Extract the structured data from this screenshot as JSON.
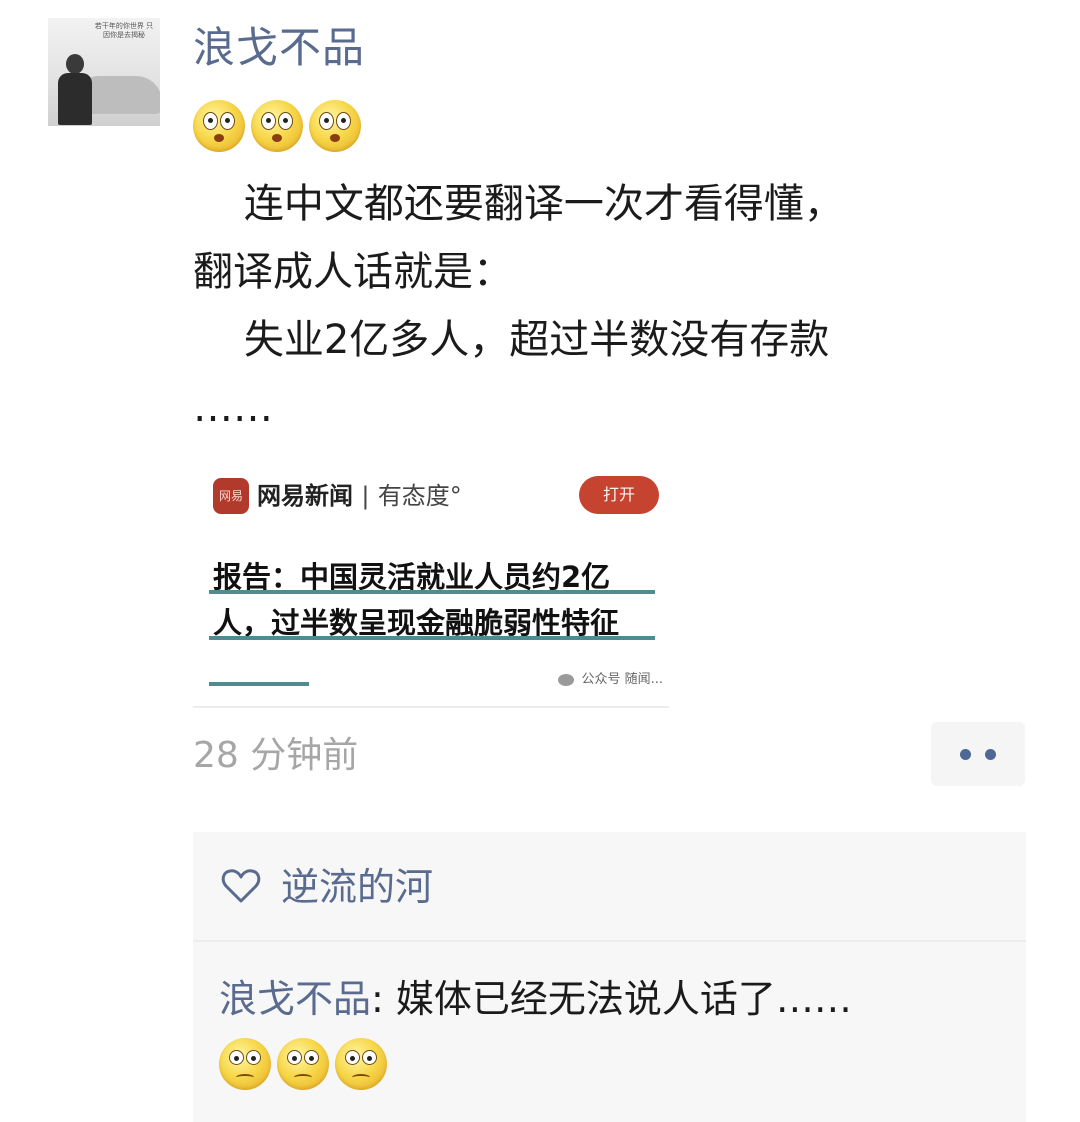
{
  "post": {
    "username": "浪戈不品",
    "avatar_caption": "若干年的你世界\n只因你是去揭秘",
    "emoji_top": [
      "blank-stare-emoji",
      "blank-stare-emoji",
      "blank-stare-emoji"
    ],
    "text_lines": [
      "    连中文都还要翻译一次才看得懂，",
      "翻译成人话就是：",
      "    失业2亿多人，超过半数没有存款",
      "……"
    ],
    "timestamp": "28 分钟前",
    "more_icon": "two-dots-icon"
  },
  "shared_card": {
    "logo_text": "网易",
    "brand_name": "网易新闻",
    "brand_separator": "|",
    "brand_slogan": "有态度°",
    "open_button": "打开",
    "headline": "报告：中国灵活就业人员约2亿人，过半数呈现金融脆弱性特征",
    "source_label": "公众号",
    "source_name": "随闻..."
  },
  "interactions": {
    "like_icon": "heart-outline-icon",
    "liker": "逆流的河",
    "comments": [
      {
        "author": "浪戈不品",
        "separator": ": ",
        "text": "媒体已经无法说人话了……",
        "emojis": [
          "worried-emoji",
          "worried-emoji",
          "worried-emoji"
        ]
      }
    ]
  },
  "colors": {
    "username": "#5a6b90",
    "timestamp": "#a6a6a6",
    "open_button": "#c6432f",
    "underline": "#4f8b8f"
  }
}
